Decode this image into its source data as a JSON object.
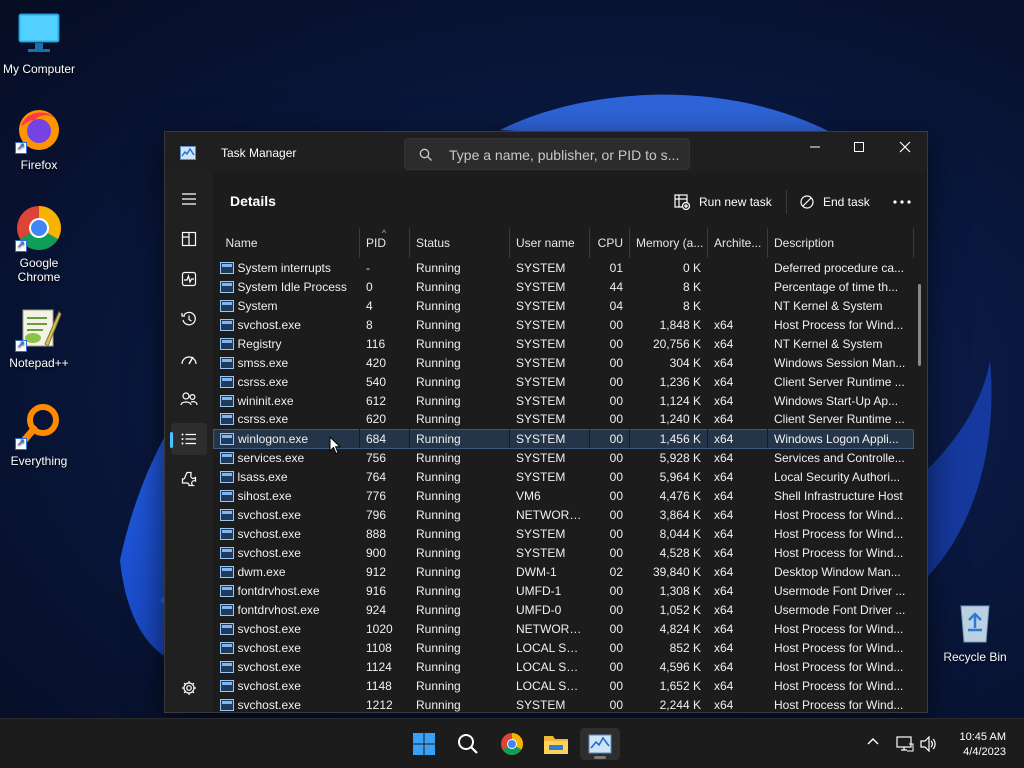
{
  "desktop": {
    "icons": [
      {
        "label": "My Computer",
        "icon": "monitor-icon"
      },
      {
        "label": "Firefox",
        "icon": "firefox-icon"
      },
      {
        "label": "Google Chrome",
        "icon": "chrome-icon"
      },
      {
        "label": "Notepad++",
        "icon": "notepadpp-icon"
      },
      {
        "label": "Everything",
        "icon": "everything-search-icon"
      },
      {
        "label": "Recycle Bin",
        "icon": "recycle-bin-icon"
      }
    ]
  },
  "window": {
    "title": "Task Manager",
    "search_placeholder": "Type a name, publisher, or PID to s...",
    "controls": {
      "minimize": "minimize-icon",
      "maximize": "maximize-icon",
      "close": "close-icon"
    }
  },
  "nav": {
    "items": [
      {
        "name": "menu",
        "icon": "hamburger-icon"
      },
      {
        "name": "processes",
        "icon": "processes-icon"
      },
      {
        "name": "performance",
        "icon": "performance-icon"
      },
      {
        "name": "app-history",
        "icon": "history-icon"
      },
      {
        "name": "startup-apps",
        "icon": "startup-icon"
      },
      {
        "name": "users",
        "icon": "users-icon"
      },
      {
        "name": "details",
        "icon": "details-list-icon",
        "active": true
      },
      {
        "name": "services",
        "icon": "services-icon"
      },
      {
        "name": "settings",
        "icon": "gear-icon"
      }
    ]
  },
  "toolbar": {
    "page_title": "Details",
    "run_new_task": "Run new task",
    "end_task": "End task",
    "more": "more-options-icon"
  },
  "table": {
    "columns": [
      "Name",
      "PID",
      "Status",
      "User name",
      "CPU",
      "Memory (a...",
      "Archite...",
      "Description"
    ],
    "rows": [
      [
        "System interrupts",
        "-",
        "Running",
        "SYSTEM",
        "01",
        "0 K",
        "",
        "Deferred procedure ca..."
      ],
      [
        "System Idle Process",
        "0",
        "Running",
        "SYSTEM",
        "44",
        "8 K",
        "",
        "Percentage of time th..."
      ],
      [
        "System",
        "4",
        "Running",
        "SYSTEM",
        "04",
        "8 K",
        "",
        "NT Kernel & System"
      ],
      [
        "svchost.exe",
        "8",
        "Running",
        "SYSTEM",
        "00",
        "1,848 K",
        "x64",
        "Host Process for Wind..."
      ],
      [
        "Registry",
        "116",
        "Running",
        "SYSTEM",
        "00",
        "20,756 K",
        "x64",
        "NT Kernel & System"
      ],
      [
        "smss.exe",
        "420",
        "Running",
        "SYSTEM",
        "00",
        "304 K",
        "x64",
        "Windows Session Man..."
      ],
      [
        "csrss.exe",
        "540",
        "Running",
        "SYSTEM",
        "00",
        "1,236 K",
        "x64",
        "Client Server Runtime ..."
      ],
      [
        "wininit.exe",
        "612",
        "Running",
        "SYSTEM",
        "00",
        "1,124 K",
        "x64",
        "Windows Start-Up Ap..."
      ],
      [
        "csrss.exe",
        "620",
        "Running",
        "SYSTEM",
        "00",
        "1,240 K",
        "x64",
        "Client Server Runtime ..."
      ],
      [
        "winlogon.exe",
        "684",
        "Running",
        "SYSTEM",
        "00",
        "1,456 K",
        "x64",
        "Windows Logon Appli..."
      ],
      [
        "services.exe",
        "756",
        "Running",
        "SYSTEM",
        "00",
        "5,928 K",
        "x64",
        "Services and Controlle..."
      ],
      [
        "lsass.exe",
        "764",
        "Running",
        "SYSTEM",
        "00",
        "5,964 K",
        "x64",
        "Local Security Authori..."
      ],
      [
        "sihost.exe",
        "776",
        "Running",
        "VM6",
        "00",
        "4,476 K",
        "x64",
        "Shell Infrastructure Host"
      ],
      [
        "svchost.exe",
        "796",
        "Running",
        "NETWORK...",
        "00",
        "3,864 K",
        "x64",
        "Host Process for Wind..."
      ],
      [
        "svchost.exe",
        "888",
        "Running",
        "SYSTEM",
        "00",
        "8,044 K",
        "x64",
        "Host Process for Wind..."
      ],
      [
        "svchost.exe",
        "900",
        "Running",
        "SYSTEM",
        "00",
        "4,528 K",
        "x64",
        "Host Process for Wind..."
      ],
      [
        "dwm.exe",
        "912",
        "Running",
        "DWM-1",
        "02",
        "39,840 K",
        "x64",
        "Desktop Window Man..."
      ],
      [
        "fontdrvhost.exe",
        "916",
        "Running",
        "UMFD-1",
        "00",
        "1,308 K",
        "x64",
        "Usermode Font Driver ..."
      ],
      [
        "fontdrvhost.exe",
        "924",
        "Running",
        "UMFD-0",
        "00",
        "1,052 K",
        "x64",
        "Usermode Font Driver ..."
      ],
      [
        "svchost.exe",
        "1020",
        "Running",
        "NETWORK...",
        "00",
        "4,824 K",
        "x64",
        "Host Process for Wind..."
      ],
      [
        "svchost.exe",
        "1108",
        "Running",
        "LOCAL SE...",
        "00",
        "852 K",
        "x64",
        "Host Process for Wind..."
      ],
      [
        "svchost.exe",
        "1124",
        "Running",
        "LOCAL SE...",
        "00",
        "4,596 K",
        "x64",
        "Host Process for Wind..."
      ],
      [
        "svchost.exe",
        "1148",
        "Running",
        "LOCAL SE...",
        "00",
        "1,652 K",
        "x64",
        "Host Process for Wind..."
      ],
      [
        "svchost.exe",
        "1212",
        "Running",
        "SYSTEM",
        "00",
        "2,244 K",
        "x64",
        "Host Process for Wind..."
      ]
    ],
    "selected_row": 9
  },
  "taskbar": {
    "apps": [
      {
        "name": "start",
        "icon": "windows-logo-icon"
      },
      {
        "name": "search",
        "icon": "search-icon"
      },
      {
        "name": "chrome",
        "icon": "chrome-icon"
      },
      {
        "name": "file-explorer",
        "icon": "folder-icon"
      },
      {
        "name": "task-manager",
        "icon": "task-manager-icon",
        "active": true
      }
    ],
    "tray": [
      "chevron-up-icon",
      "network-icon",
      "volume-icon"
    ],
    "time": "10:45 AM",
    "date": "4/4/2023"
  },
  "colors": {
    "accent": "#4cc2ff",
    "selected_row_bg": "#24354a",
    "window_bg": "#202020"
  }
}
